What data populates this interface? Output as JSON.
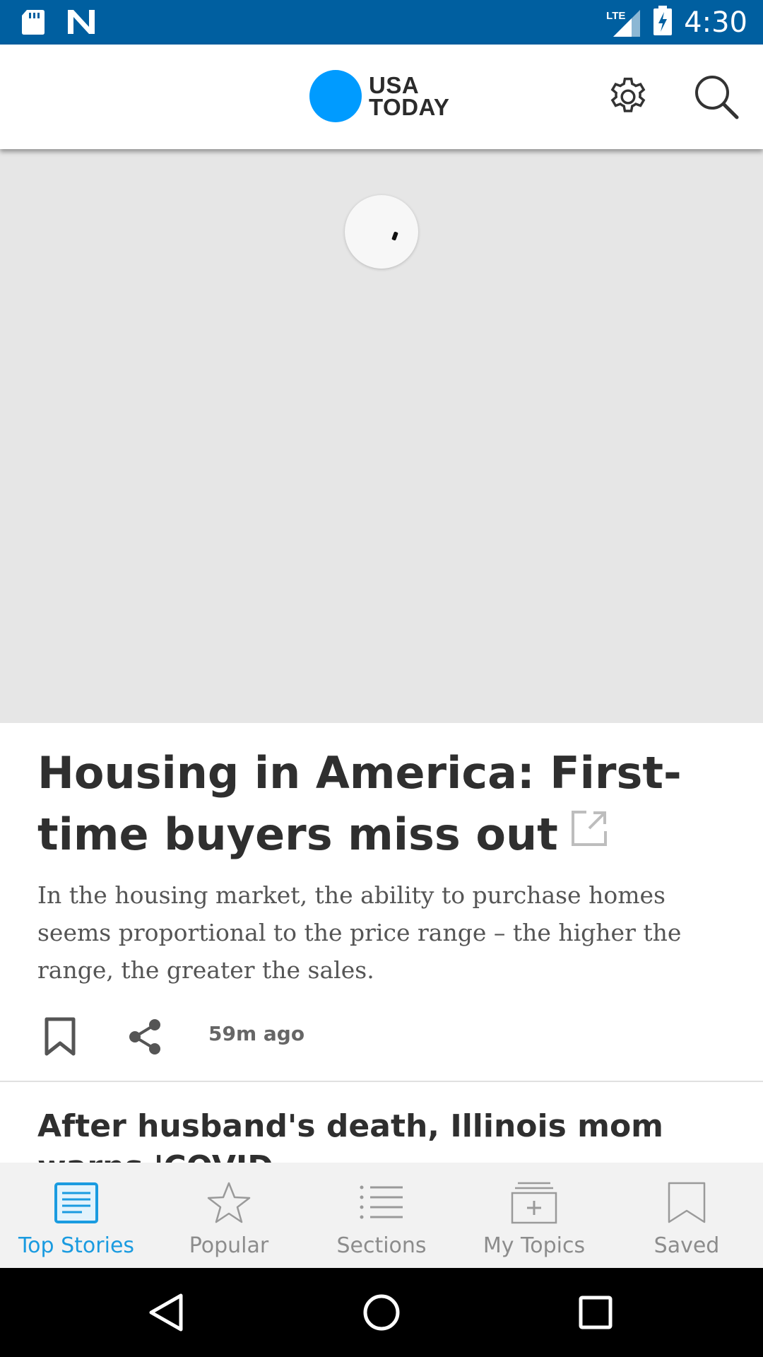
{
  "status_bar": {
    "time": "4:30",
    "network": "LTE",
    "icons": [
      "sd-card-icon",
      "notification-n-icon",
      "signal-icon",
      "battery-charging-icon"
    ]
  },
  "header": {
    "logo_line1": "USA",
    "logo_line2": "TODAY",
    "logo_color": "#009bff",
    "icons": [
      "gear-icon",
      "search-icon"
    ]
  },
  "hero": {
    "background": "#e6e6e6",
    "loading": true
  },
  "article": {
    "title": "Housing in America:  First-time buyers miss out",
    "summary": "In the housing market, the ability to purchase homes seems proportional to the price range – the higher the range, the greater the sales.",
    "timestamp": "59m ago"
  },
  "next_article": {
    "title": "After husband's death, Illinois mom warns 'COVID"
  },
  "bottom_nav": {
    "accent": "#1a9be0",
    "items": [
      {
        "label": "Top Stories",
        "icon": "newspaper-icon",
        "active": true
      },
      {
        "label": "Popular",
        "icon": "star-icon",
        "active": false
      },
      {
        "label": "Sections",
        "icon": "list-icon",
        "active": false
      },
      {
        "label": "My Topics",
        "icon": "add-topic-icon",
        "active": false
      },
      {
        "label": "Saved",
        "icon": "bookmark-icon",
        "active": false
      }
    ]
  },
  "system_nav": {
    "icons": [
      "back-icon",
      "home-icon",
      "recents-icon"
    ]
  }
}
